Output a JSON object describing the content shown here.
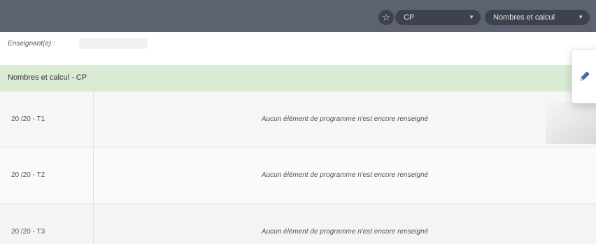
{
  "toolbar": {
    "favorite_icon": "star-icon",
    "level_select": {
      "value": "CP"
    },
    "domain_select": {
      "value": "Nombres et calcul"
    }
  },
  "teacher": {
    "label": "Enseignant(e) :"
  },
  "section": {
    "title": "Nombres et calcul - CP"
  },
  "rows": [
    {
      "period": "20   /20   - T1",
      "message": "Aucun élément de programme n'est encore renseigné"
    },
    {
      "period": "20   /20   - T2",
      "message": "Aucun élément de programme n'est encore renseigné"
    },
    {
      "period": "20   /20   - T3",
      "message": "Aucun élément de programme n'est encore renseigné"
    }
  ],
  "colors": {
    "topbar": "#5c6270",
    "pill": "#3e424d",
    "section_header": "#d9ebd2"
  }
}
